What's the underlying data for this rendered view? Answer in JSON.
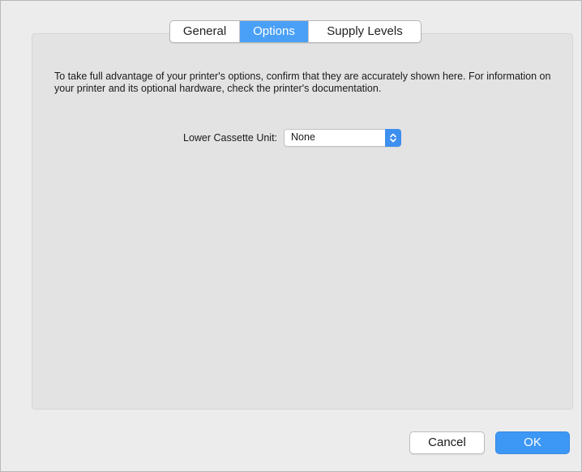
{
  "tabs": [
    {
      "label": "General",
      "active": false
    },
    {
      "label": "Options",
      "active": true
    },
    {
      "label": "Supply Levels",
      "active": false
    }
  ],
  "options": {
    "description": "To take full advantage of your printer's options, confirm that they are accurately shown here. For information on your printer and its optional hardware, check the printer's documentation.",
    "lower_cassette_label": "Lower Cassette Unit:",
    "lower_cassette_value": "None"
  },
  "buttons": {
    "cancel_label": "Cancel",
    "ok_label": "OK"
  },
  "colors": {
    "accent": "#4aa0f6",
    "ok_button": "#3d97f5",
    "panel_bg": "#e3e3e3",
    "window_bg": "#ececec"
  },
  "icons": {
    "select_stepper": "up-down-chevron-icon"
  }
}
